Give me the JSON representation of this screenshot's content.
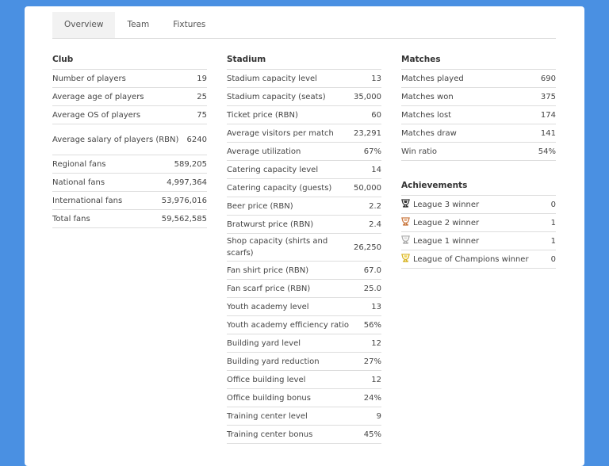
{
  "tabs": [
    "Overview",
    "Team",
    "Fixtures"
  ],
  "club": {
    "title": "Club",
    "rows": [
      {
        "label": "Number of players",
        "value": "19"
      },
      {
        "label": "Average age of players",
        "value": "25"
      },
      {
        "label": "Average OS of players",
        "value": "75"
      },
      {
        "label": "Average salary of players (RBN)",
        "value": "6240"
      },
      {
        "label": "Regional fans",
        "value": "589,205"
      },
      {
        "label": "National fans",
        "value": "4,997,364"
      },
      {
        "label": "International fans",
        "value": "53,976,016"
      },
      {
        "label": "Total fans",
        "value": "59,562,585"
      }
    ]
  },
  "stadium": {
    "title": "Stadium",
    "rows": [
      {
        "label": "Stadium capacity level",
        "value": "13"
      },
      {
        "label": "Stadium capacity (seats)",
        "value": "35,000"
      },
      {
        "label": "Ticket price (RBN)",
        "value": "60"
      },
      {
        "label": "Average visitors per match",
        "value": "23,291"
      },
      {
        "label": "Average utilization",
        "value": "67%"
      },
      {
        "label": "Catering capacity level",
        "value": "14"
      },
      {
        "label": "Catering capacity (guests)",
        "value": "50,000"
      },
      {
        "label": "Beer price (RBN)",
        "value": "2.2"
      },
      {
        "label": "Bratwurst price (RBN)",
        "value": "2.4"
      },
      {
        "label": "Shop capacity (shirts and scarfs)",
        "value": "26,250"
      },
      {
        "label": "Fan shirt price (RBN)",
        "value": "67.0"
      },
      {
        "label": "Fan scarf price (RBN)",
        "value": "25.0"
      },
      {
        "label": "Youth academy level",
        "value": "13"
      },
      {
        "label": "Youth academy efficiency ratio",
        "value": "56%"
      },
      {
        "label": "Building yard level",
        "value": "12"
      },
      {
        "label": "Building yard reduction",
        "value": "27%"
      },
      {
        "label": "Office building level",
        "value": "12"
      },
      {
        "label": "Office building bonus",
        "value": "24%"
      },
      {
        "label": "Training center level",
        "value": "9"
      },
      {
        "label": "Training center bonus",
        "value": "45%"
      }
    ]
  },
  "matches": {
    "title": "Matches",
    "rows": [
      {
        "label": "Matches played",
        "value": "690"
      },
      {
        "label": "Matches won",
        "value": "375"
      },
      {
        "label": "Matches lost",
        "value": "174"
      },
      {
        "label": "Matches draw",
        "value": "141"
      },
      {
        "label": "Win ratio",
        "value": "54%"
      }
    ]
  },
  "achievements": {
    "title": "Achievements",
    "rows": [
      {
        "label": "League 3 winner",
        "value": "0",
        "icon": "league-3-trophy-icon",
        "color": "#2f2f2f"
      },
      {
        "label": "League 2 winner",
        "value": "1",
        "icon": "league-2-trophy-icon",
        "color": "#c8743a"
      },
      {
        "label": "League 1 winner",
        "value": "1",
        "icon": "league-1-trophy-icon",
        "color": "#a8a8a8"
      },
      {
        "label": "League of Champions winner",
        "value": "0",
        "icon": "champions-trophy-icon",
        "color": "#d6b21e"
      }
    ]
  }
}
